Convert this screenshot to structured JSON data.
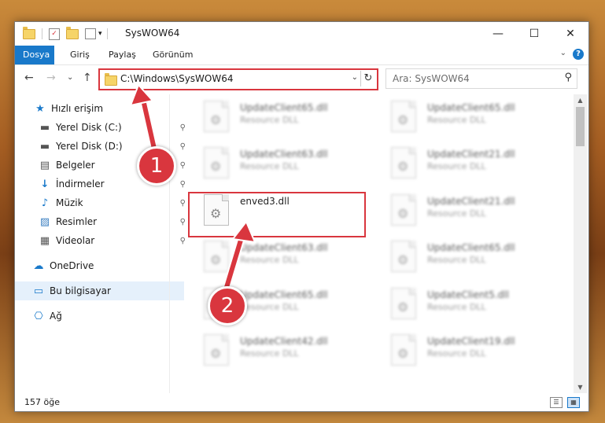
{
  "window": {
    "title": "SysWOW64",
    "minimize_symbol": "—",
    "maximize_symbol": "☐",
    "close_symbol": "✕"
  },
  "quick_access": {
    "properties_symbol": "✓",
    "dropdown_symbol": "▾"
  },
  "ribbon": {
    "tabs": [
      "Dosya",
      "Giriş",
      "Paylaş",
      "Görünüm"
    ],
    "collapse_symbol": "⌄",
    "help_symbol": "?"
  },
  "nav": {
    "back_symbol": "←",
    "forward_symbol": "→",
    "recent_symbol": "⌄",
    "up_symbol": "↑",
    "address_path": "C:\\Windows\\SysWOW64",
    "address_dropdown_symbol": "⌄",
    "refresh_symbol": "↻",
    "search_placeholder": "Ara: SysWOW64",
    "search_symbol": "⚲"
  },
  "sidebar": {
    "items": [
      {
        "label": "Hızlı erişim",
        "icon": "★",
        "icon_name": "star-icon",
        "pinned": false
      },
      {
        "label": "Yerel Disk (C:)",
        "icon": "▬",
        "icon_name": "drive-icon",
        "pinned": true
      },
      {
        "label": "Yerel Disk (D:)",
        "icon": "▬",
        "icon_name": "drive-icon",
        "pinned": true
      },
      {
        "label": "Belgeler",
        "icon": "▤",
        "icon_name": "documents-icon",
        "pinned": true
      },
      {
        "label": "İndirmeler",
        "icon": "↓",
        "icon_name": "download-icon",
        "pinned": true
      },
      {
        "label": "Müzik",
        "icon": "♪",
        "icon_name": "music-icon",
        "pinned": true
      },
      {
        "label": "Resimler",
        "icon": "▨",
        "icon_name": "pictures-icon",
        "pinned": true
      },
      {
        "label": "Videolar",
        "icon": "▦",
        "icon_name": "videos-icon",
        "pinned": true
      },
      {
        "label": "OneDrive",
        "icon": "☁",
        "icon_name": "cloud-icon",
        "pinned": false
      },
      {
        "label": "Bu bilgisayar",
        "icon": "▭",
        "icon_name": "computer-icon",
        "pinned": false,
        "selected": true
      },
      {
        "label": "Ağ",
        "icon": "⎔",
        "icon_name": "network-icon",
        "pinned": false
      }
    ],
    "pin_symbol": "⚲",
    "expand_symbol": "›"
  },
  "files": [
    {
      "name": "UpdateClient65.dll",
      "desc": "Resource DLL",
      "blur": true
    },
    {
      "name": "UpdateClient65.dll",
      "desc": "Resource DLL",
      "blur": true
    },
    {
      "name": "UpdateClient63.dll",
      "desc": "Resource DLL",
      "blur": true
    },
    {
      "name": "UpdateClient21.dll",
      "desc": "Resource DLL",
      "blur": true
    },
    {
      "name": "enved3.dll",
      "desc": "",
      "blur": false
    },
    {
      "name": "UpdateClient21.dll",
      "desc": "Resource DLL",
      "blur": true
    },
    {
      "name": "UpdateClient63.dll",
      "desc": "Resource DLL",
      "blur": true
    },
    {
      "name": "UpdateClient65.dll",
      "desc": "Resource DLL",
      "blur": true
    },
    {
      "name": "UpdateClient65.dll",
      "desc": "Resource DLL",
      "blur": true
    },
    {
      "name": "UpdateClient5.dll",
      "desc": "Resource DLL",
      "blur": true
    },
    {
      "name": "UpdateClient42.dll",
      "desc": "Resource DLL",
      "blur": true
    },
    {
      "name": "UpdateClient19.dll",
      "desc": "Resource DLL",
      "blur": true
    }
  ],
  "file_icon_symbol": "⚙",
  "scrollbar": {
    "up_symbol": "▲",
    "down_symbol": "▼"
  },
  "status": {
    "count": "157 öğe",
    "details_view_symbol": "☰",
    "icons_view_symbol": "▦"
  },
  "annotations": {
    "step1": "1",
    "step2": "2",
    "color": "#d9363e"
  }
}
